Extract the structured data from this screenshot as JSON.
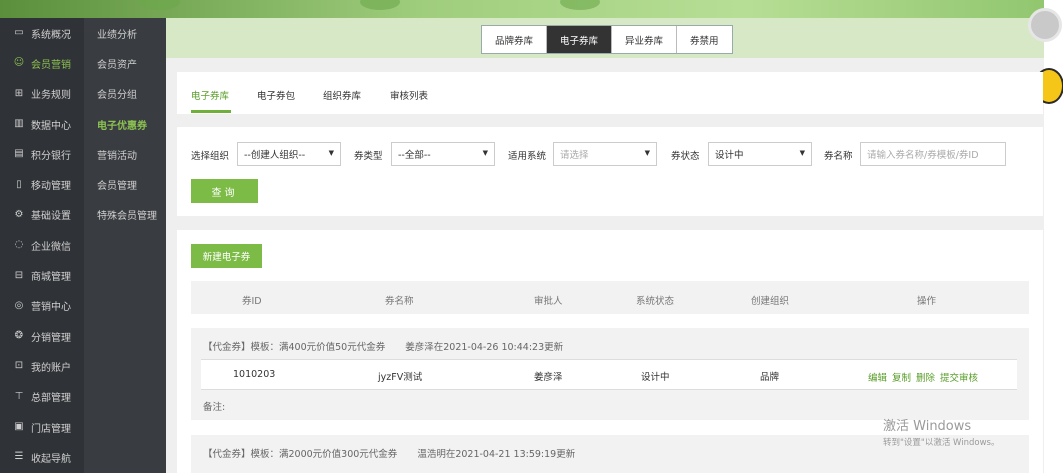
{
  "sidebar_primary": [
    {
      "label": "系统概况",
      "icon": "monitor-icon"
    },
    {
      "label": "会员营销",
      "icon": "member-icon",
      "active": true
    },
    {
      "label": "业务规则",
      "icon": "grid-icon"
    },
    {
      "label": "数据中心",
      "icon": "bar-chart-icon"
    },
    {
      "label": "积分银行",
      "icon": "bank-icon"
    },
    {
      "label": "移动管理",
      "icon": "mobile-icon"
    },
    {
      "label": "基础设置",
      "icon": "gear-icon"
    },
    {
      "label": "企业微信",
      "icon": "wechat-icon"
    },
    {
      "label": "商城管理",
      "icon": "shop-icon"
    },
    {
      "label": "营销中心",
      "icon": "marketing-icon"
    },
    {
      "label": "分销管理",
      "icon": "distribution-icon"
    },
    {
      "label": "我的账户",
      "icon": "account-icon"
    },
    {
      "label": "总部管理",
      "icon": "headquarters-icon"
    },
    {
      "label": "门店管理",
      "icon": "store-icon"
    },
    {
      "label": "收起导航",
      "icon": "menu-icon"
    }
  ],
  "sidebar_secondary": [
    {
      "label": "业绩分析"
    },
    {
      "label": "会员资产"
    },
    {
      "label": "会员分组"
    },
    {
      "label": "电子优惠券",
      "active": true
    },
    {
      "label": "营销活动"
    },
    {
      "label": "会员管理"
    },
    {
      "label": "特殊会员管理"
    }
  ],
  "type_tabs": [
    {
      "label": "品牌券库"
    },
    {
      "label": "电子券库",
      "active": true
    },
    {
      "label": "异业券库"
    },
    {
      "label": "券禁用"
    }
  ],
  "sub_tabs": [
    {
      "label": "电子券库",
      "active": true
    },
    {
      "label": "电子券包"
    },
    {
      "label": "组织券库"
    },
    {
      "label": "审核列表"
    }
  ],
  "filters": {
    "org_label": "选择组织",
    "org_value": "--创建人组织--",
    "type_label": "券类型",
    "type_value": "--全部--",
    "system_label": "适用系统",
    "system_placeholder": "请选择",
    "status_label": "券状态",
    "status_value": "设计中",
    "name_label": "券名称",
    "name_placeholder": "请输入券名称/券模板/券ID",
    "query_button": "查询"
  },
  "list": {
    "new_button": "新建电子券",
    "columns": [
      "券ID",
      "券名称",
      "审批人",
      "系统状态",
      "创建组织",
      "操作"
    ],
    "coupons": [
      {
        "header": "【代金券】模板：满400元价值50元代金券",
        "updated": "姜彦泽在2021-04-26 10:44:23更新",
        "id": "1010203",
        "name": "jyzFV测试",
        "approver": "姜彦泽",
        "status": "设计中",
        "org": "品牌",
        "remark": "备注:"
      },
      {
        "header": "【代金券】模板：满2000元价值300元代金券",
        "updated": "温浩明在2021-04-21 13:59:19更新"
      }
    ],
    "ops": [
      "编辑",
      "复制",
      "删除",
      "提交审核"
    ]
  },
  "watermark": {
    "line1": "激活 Windows",
    "line2": "转到\"设置\"以激活 Windows。"
  },
  "colors": {
    "accent": "#7cbb46",
    "sidebar_dark": "#2f3236",
    "header_bg": "#d6e8c6"
  }
}
